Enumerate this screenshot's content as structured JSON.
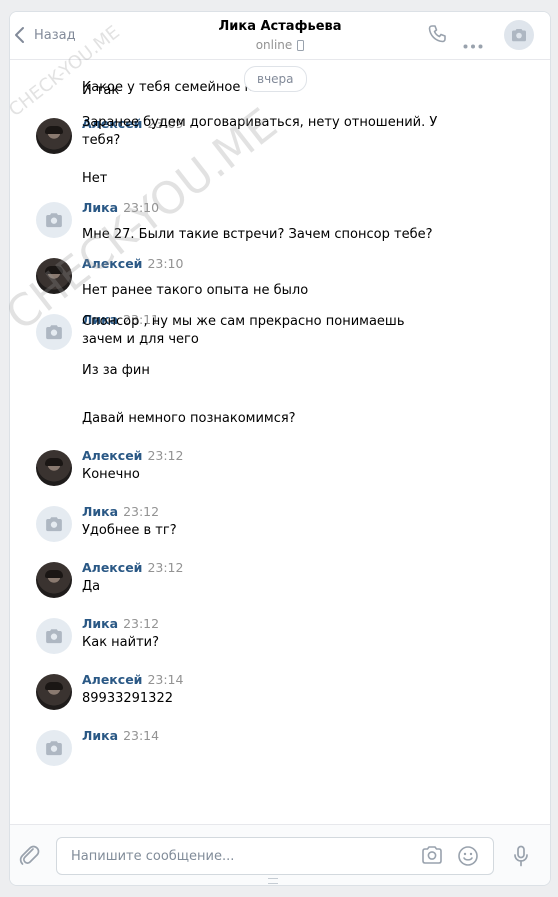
{
  "header": {
    "back_label": "Назад",
    "contact_name": "Лика Астафьева",
    "status": "online"
  },
  "date_divider": "вчера",
  "messages": [
    {
      "author": "",
      "time": "",
      "texts": [
        "Какое у тебя семейное пол"
      ],
      "avatar": "none"
    },
    {
      "author": "Алексей",
      "time": "23:09",
      "texts": [
        "И так",
        "Заранее будем договариваться, нету отношений. У тебя?"
      ],
      "avatar": "photo"
    },
    {
      "author": "Лика",
      "time": "23:10",
      "texts": [
        "Нет"
      ],
      "avatar": "camera"
    },
    {
      "author": "Алексей",
      "time": "23:10",
      "texts": [
        "Мне 27. Были такие встречи? Зачем спонсор тебе?"
      ],
      "avatar": "photo"
    },
    {
      "author": "Лика",
      "time": "23:11",
      "texts": [
        "Нет ранее такого опыта не было",
        "Спонсор , ну мы же сам прекрасно понимаешь зачем и для чего",
        "Из за фин"
      ],
      "avatar": "camera"
    },
    {
      "author": "Алексей",
      "time": "23:12",
      "texts": [
        "Давай немного познакомимся?"
      ],
      "avatar": "photo"
    },
    {
      "author": "Лика",
      "time": "23:12",
      "texts": [
        "Конечно"
      ],
      "avatar": "camera"
    },
    {
      "author": "Алексей",
      "time": "23:12",
      "texts": [
        "Удобнее в тг?"
      ],
      "avatar": "photo"
    },
    {
      "author": "Лика",
      "time": "23:12",
      "texts": [
        "Да"
      ],
      "avatar": "camera"
    },
    {
      "author": "Алексей",
      "time": "23:14",
      "texts": [
        "Как найти?"
      ],
      "avatar": "photo"
    },
    {
      "author": "Лика",
      "time": "23:14",
      "texts": [
        "89933291322"
      ],
      "avatar": "camera"
    }
  ],
  "composer": {
    "placeholder": "Напишите сообщение..."
  },
  "watermark": "CHECK-YOU.ME"
}
